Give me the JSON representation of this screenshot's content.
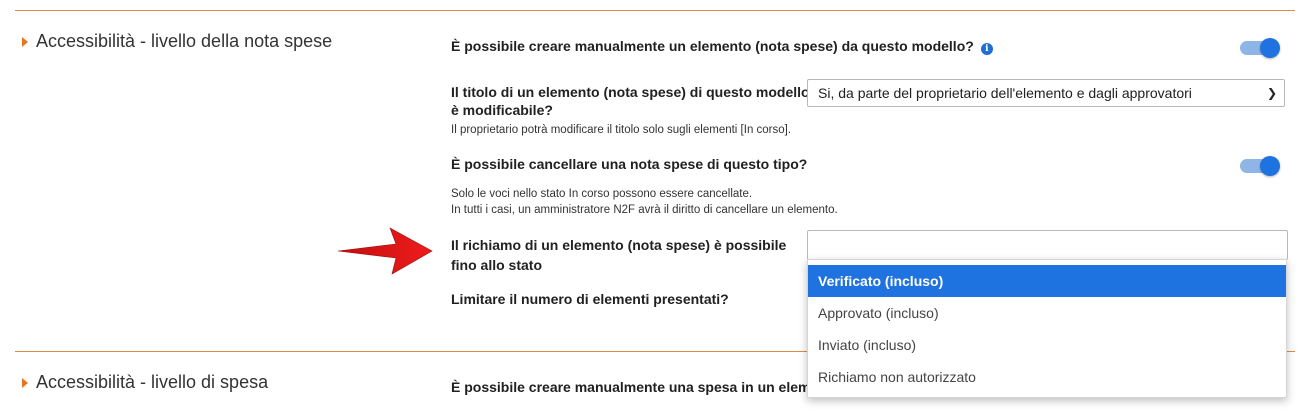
{
  "section1": {
    "title": "Accessibilità - livello della nota spese",
    "q1": "È possibile creare manualmente un elemento (nota spese) da questo modello?",
    "q1_toggle": true,
    "q2_line1": "Il titolo di un elemento (nota spese) di questo modello",
    "q2_line2": "è modificabile?",
    "q2_note": "Il proprietario potrà modificare il titolo solo sugli elementi [In corso].",
    "q2_select_value": "Si, da parte del proprietario dell'elemento e dagli approvatori",
    "q3": "È possibile cancellare una nota spese di questo tipo?",
    "q3_toggle": true,
    "q3_note1": "Solo le voci nello stato In corso possono essere cancellate.",
    "q3_note2": "In tutti i casi, un amministratore N2F avrà il diritto di cancellare un elemento.",
    "q4_line1": "Il richiamo di un elemento (nota spese) è possibile",
    "q4_line2": "fino allo stato",
    "q4_select_value": "",
    "q4_options": [
      "Verificato (incluso)",
      "Approvato (incluso)",
      "Inviato (incluso)",
      "Richiamo non autorizzato"
    ],
    "q4_selected_index": 0,
    "q5": "Limitare il numero di elementi presentati?"
  },
  "section2": {
    "title": "Accessibilità - livello di spesa",
    "q1": "È possibile creare manualmente una spesa in un elemento"
  },
  "colors": {
    "accent": "#1f73e0",
    "divider": "#e08a4a",
    "arrow": "#e01414"
  },
  "icons": {
    "info": "info-icon",
    "section_caret": "caret-right-icon",
    "select_chevron": "chevron-down-icon"
  }
}
